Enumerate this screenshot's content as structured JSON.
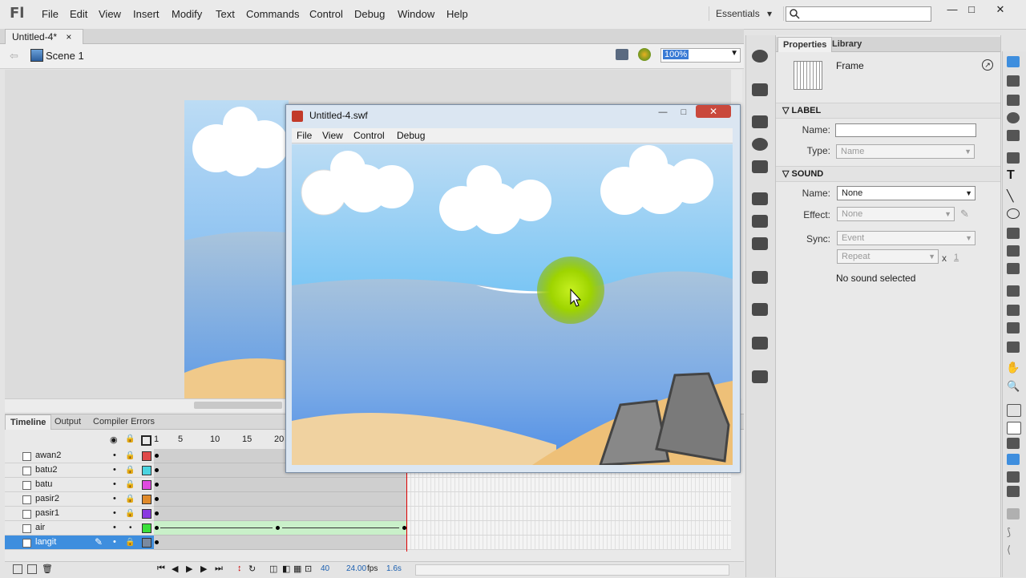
{
  "app": {
    "logo": "Fl"
  },
  "menu": [
    "File",
    "Edit",
    "View",
    "Insert",
    "Modify",
    "Text",
    "Commands",
    "Control",
    "Debug",
    "Window",
    "Help"
  ],
  "workspace": {
    "label": "Essentials",
    "arrow": "▾"
  },
  "window_controls": {
    "minimize": "—",
    "maximize": "□",
    "close": "✕"
  },
  "document": {
    "tab": "Untitled-4*",
    "close": "×",
    "scene": "Scene 1",
    "zoom": "100%"
  },
  "timeline": {
    "tabs": [
      "Timeline",
      "Output",
      "Compiler Errors"
    ],
    "frame_numbers": [
      "1",
      "5",
      "10",
      "15",
      "20"
    ],
    "layers": [
      {
        "name": "awan2",
        "color": "#e04a4a"
      },
      {
        "name": "batu2",
        "color": "#4ad4e0"
      },
      {
        "name": "batu",
        "color": "#e04ae0"
      },
      {
        "name": "pasir2",
        "color": "#e08a2a"
      },
      {
        "name": "pasir1",
        "color": "#8a3ae0"
      },
      {
        "name": "air",
        "color": "#3ae03a"
      },
      {
        "name": "langit",
        "color": "#7a8aa0"
      }
    ],
    "selected_layer": "langit",
    "footer": {
      "frame": "40",
      "fps": "24.00",
      "fps_label": "fps",
      "time": "1.6s"
    }
  },
  "panels": {
    "tabs": [
      "Properties",
      "Library"
    ],
    "frame_label": "Frame",
    "label_section": {
      "title": "LABEL",
      "name_label": "Name:",
      "name_value": "",
      "type_label": "Type:",
      "type_value": "Name"
    },
    "sound_section": {
      "title": "SOUND",
      "name_label": "Name:",
      "name_value": "None",
      "effect_label": "Effect:",
      "effect_value": "None",
      "sync_label": "Sync:",
      "sync_value": "Event",
      "repeat_value": "Repeat",
      "x": "x",
      "count": "1",
      "status": "No sound selected"
    }
  },
  "swf_window": {
    "title": "Untitled-4.swf",
    "menu": [
      "File",
      "View",
      "Control",
      "Debug"
    ],
    "close": "✕",
    "minimize": "—",
    "maximize": "□"
  },
  "colors": {
    "sky_top": "#bcdcf4",
    "sky_bottom": "#62aaf0",
    "water": "#a9c4dc",
    "sand": "#f0c98a",
    "rock": "#808080",
    "sun": "#9ed400",
    "selection": "#3e8ede"
  }
}
